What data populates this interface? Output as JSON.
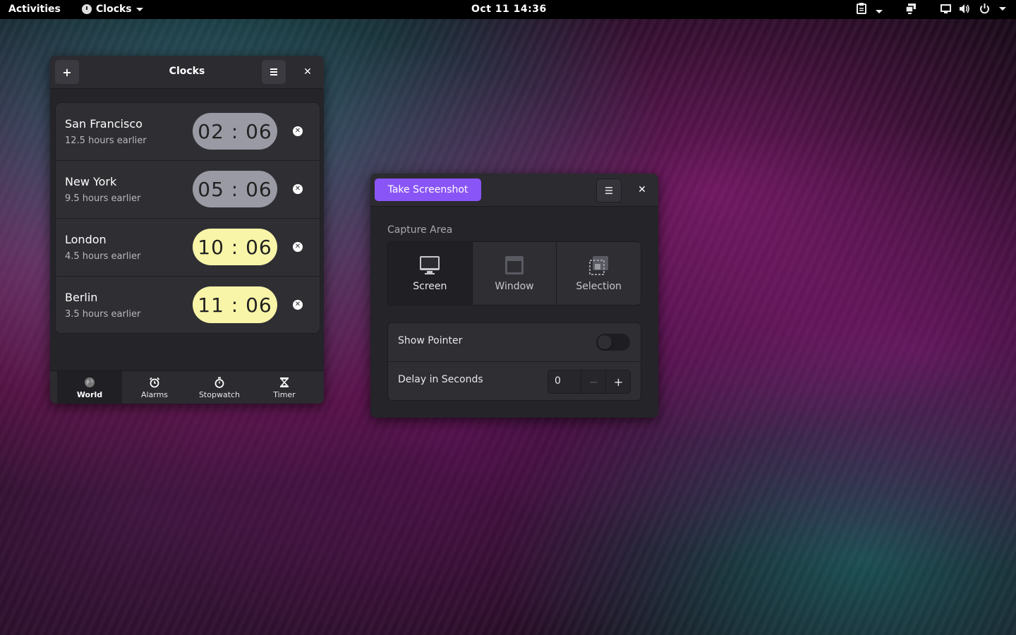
{
  "topbar": {
    "activities": "Activities",
    "app_name": "Clocks",
    "datetime": "Oct 11  14:36",
    "icons": [
      "clipboard-icon",
      "display-icon",
      "screen-icon",
      "volume-icon",
      "power-icon"
    ]
  },
  "clocks": {
    "title": "Clocks",
    "add_label": "+",
    "cities": [
      {
        "name": "San Francisco",
        "offset": "12.5 hours earlier",
        "time": "02 : 06",
        "period": "night"
      },
      {
        "name": "New York",
        "offset": "9.5 hours earlier",
        "time": "05 : 06",
        "period": "night"
      },
      {
        "name": "London",
        "offset": "4.5 hours earlier",
        "time": "10 : 06",
        "period": "day"
      },
      {
        "name": "Berlin",
        "offset": "3.5 hours earlier",
        "time": "11 : 06",
        "period": "day"
      }
    ],
    "tabs": [
      {
        "label": "World",
        "icon": "globe-icon",
        "active": true
      },
      {
        "label": "Alarms",
        "icon": "alarm-icon",
        "active": false
      },
      {
        "label": "Stopwatch",
        "icon": "stopwatch-icon",
        "active": false
      },
      {
        "label": "Timer",
        "icon": "hourglass-icon",
        "active": false
      }
    ]
  },
  "screenshot": {
    "take_label": "Take Screenshot",
    "capture_area_label": "Capture Area",
    "modes": [
      {
        "label": "Screen",
        "icon": "monitor-icon",
        "selected": true
      },
      {
        "label": "Window",
        "icon": "window-icon",
        "selected": false
      },
      {
        "label": "Selection",
        "icon": "selection-icon",
        "selected": false
      }
    ],
    "show_pointer_label": "Show Pointer",
    "show_pointer": false,
    "delay_label": "Delay in Seconds",
    "delay_value": "0",
    "accent": "#8a55f7"
  }
}
